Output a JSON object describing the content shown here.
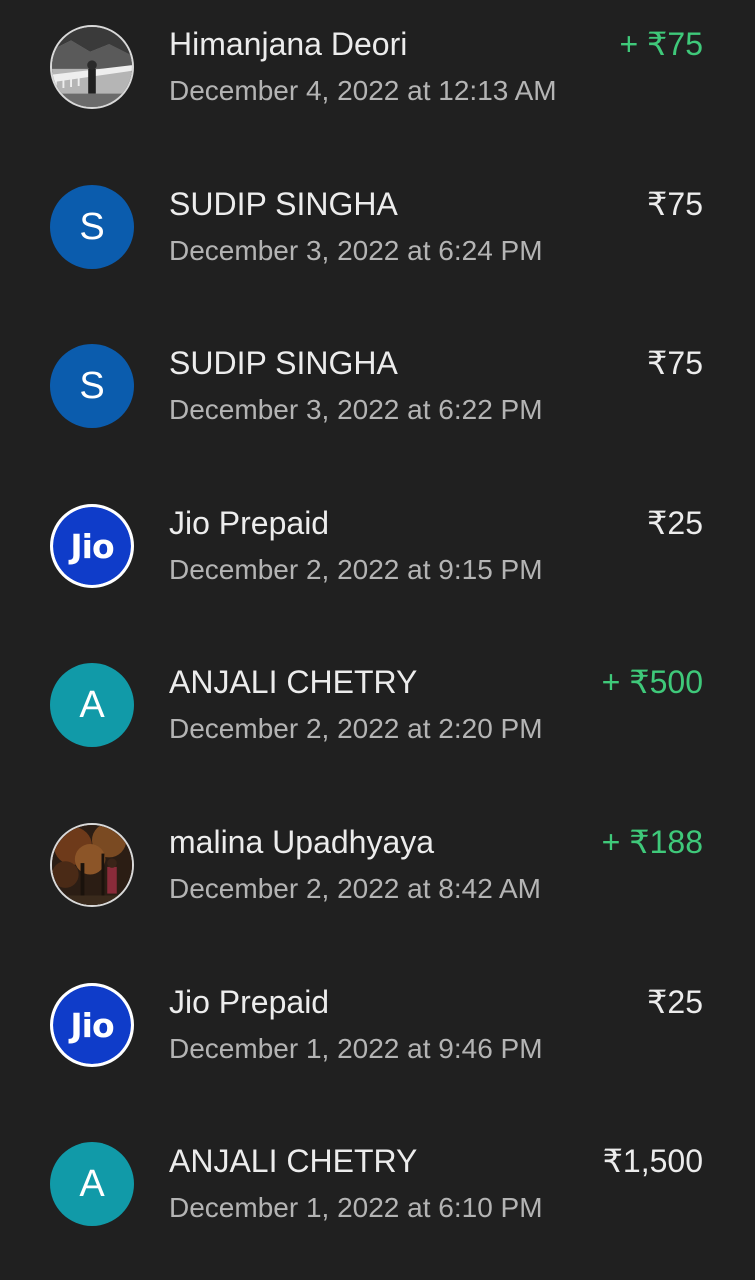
{
  "colors": {
    "background": "#202020",
    "credit": "#3fc97a",
    "avatar_blue": "#0b5cad",
    "avatar_teal": "#119aa8",
    "jio_blue": "#0f3cc9"
  },
  "transactions": [
    {
      "name": "Himanjana Deori",
      "date": "December 4, 2022 at 12:13 AM",
      "amount": "+ ₹75",
      "credit": true,
      "avatar_type": "photo",
      "avatar_icon": "profile-photo-bridge"
    },
    {
      "name": "SUDIP SINGHA",
      "date": "December 3, 2022 at 6:24 PM",
      "amount": "₹75",
      "credit": false,
      "avatar_type": "letter",
      "avatar_letter": "S",
      "avatar_color": "#0b5cad"
    },
    {
      "name": "SUDIP SINGHA",
      "date": "December 3, 2022 at 6:22 PM",
      "amount": "₹75",
      "credit": false,
      "avatar_type": "letter",
      "avatar_letter": "S",
      "avatar_color": "#0b5cad"
    },
    {
      "name": "Jio Prepaid",
      "date": "December 2, 2022 at 9:15 PM",
      "amount": "₹25",
      "credit": false,
      "avatar_type": "jio",
      "avatar_letter": "Jio"
    },
    {
      "name": "ANJALI CHETRY",
      "date": "December 2, 2022 at 2:20 PM",
      "amount": "+ ₹500",
      "credit": true,
      "avatar_type": "letter",
      "avatar_letter": "A",
      "avatar_color": "#119aa8"
    },
    {
      "name": "malina Upadhyaya",
      "date": "December 2, 2022 at 8:42 AM",
      "amount": "+ ₹188",
      "credit": true,
      "avatar_type": "photo",
      "avatar_icon": "profile-photo-autumn"
    },
    {
      "name": "Jio Prepaid",
      "date": "December 1, 2022 at 9:46 PM",
      "amount": "₹25",
      "credit": false,
      "avatar_type": "jio",
      "avatar_letter": "Jio"
    },
    {
      "name": "ANJALI CHETRY",
      "date": "December 1, 2022 at 6:10 PM",
      "amount": "₹1,500",
      "credit": false,
      "avatar_type": "letter",
      "avatar_letter": "A",
      "avatar_color": "#119aa8"
    }
  ]
}
